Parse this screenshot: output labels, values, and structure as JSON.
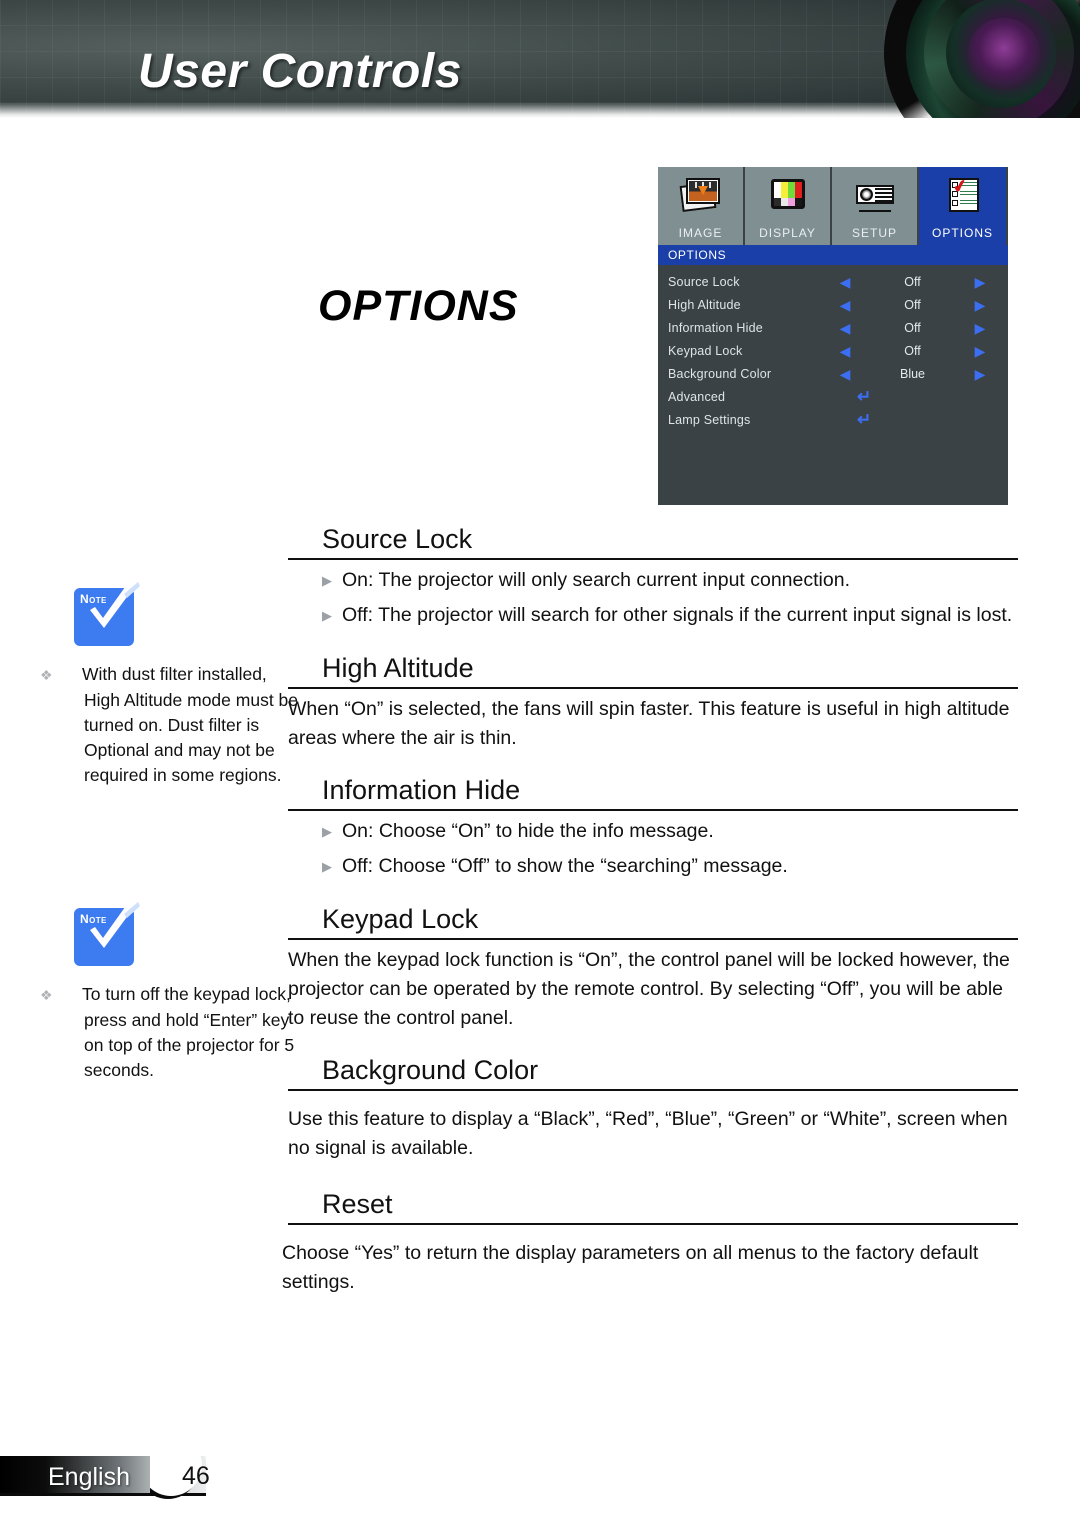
{
  "header": {
    "title": "User Controls",
    "lens_icon": "camera-lens-icon"
  },
  "section_title": "OPTIONS",
  "osd": {
    "tabs": [
      {
        "label": "IMAGE",
        "icon": "image-icon",
        "active": false
      },
      {
        "label": "DISPLAY",
        "icon": "display-icon",
        "active": false
      },
      {
        "label": "SETUP",
        "icon": "setup-icon",
        "active": false
      },
      {
        "label": "OPTIONS",
        "icon": "options-icon",
        "active": true
      }
    ],
    "menu_title": "OPTIONS",
    "rows": [
      {
        "label": "Source Lock",
        "value": "Off",
        "type": "spinner"
      },
      {
        "label": "High Altitude",
        "value": "Off",
        "type": "spinner"
      },
      {
        "label": "Information Hide",
        "value": "Off",
        "type": "spinner"
      },
      {
        "label": "Keypad Lock",
        "value": "Off",
        "type": "spinner"
      },
      {
        "label": "Background Color",
        "value": "Blue",
        "type": "spinner"
      },
      {
        "label": "Advanced",
        "value": "",
        "type": "enter"
      },
      {
        "label": "Lamp Settings",
        "value": "",
        "type": "enter"
      }
    ],
    "left_arrow": "◀",
    "right_arrow": "▶",
    "enter_glyph": "↵",
    "colors": {
      "title_bar": "#1b3fa8",
      "body": "#3a4245",
      "tab": "#808f92",
      "arrow": "#3b6ef0"
    }
  },
  "notes": [
    {
      "badge_label": "Note",
      "text": "With dust filter installed, High Altitude mode must be turned on. Dust filter is Optional and may not be required in some regions."
    },
    {
      "badge_label": "Note",
      "text": "To turn off the keypad lock, press and hold “Enter” key on top of the projector for 5 seconds."
    }
  ],
  "sections": [
    {
      "heading": "Source Lock",
      "paragraphs": [],
      "bullets": [
        "On: The projector will only search current input connection.",
        "Off: The projector will search for other signals if the current input signal is lost."
      ]
    },
    {
      "heading": "High Altitude",
      "paragraphs": [
        "When “On” is selected, the fans will spin faster. This feature is useful in high altitude areas where the air is thin."
      ],
      "bullets": []
    },
    {
      "heading": "Information Hide",
      "paragraphs": [],
      "bullets": [
        "On: Choose “On” to hide the info message.",
        "Off: Choose “Off” to show the “searching” message."
      ]
    },
    {
      "heading": "Keypad Lock",
      "paragraphs": [
        "When the keypad lock function is “On”, the control panel will be locked however, the projector can be operated by the remote control. By selecting “Off”, you will be able to reuse the control panel."
      ],
      "bullets": []
    },
    {
      "heading": "Background Color",
      "paragraphs": [
        "Use this feature to display a “Black”, “Red”, “Blue”, “Green” or “White”, screen when no signal is available."
      ],
      "bullets": []
    },
    {
      "heading": "Reset",
      "paragraphs": [
        "Choose “Yes” to return the display parameters on all menus to the factory default settings."
      ],
      "bullets": []
    }
  ],
  "footer": {
    "language": "English",
    "page_number": "46"
  }
}
